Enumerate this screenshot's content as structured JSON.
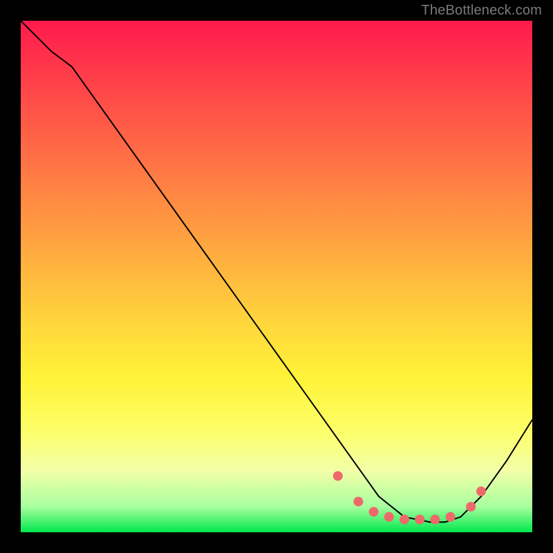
{
  "attribution": "TheBottleneck.com",
  "chart_data": {
    "type": "line",
    "title": "",
    "xlabel": "",
    "ylabel": "",
    "xlim": [
      0,
      100
    ],
    "ylim": [
      0,
      100
    ],
    "series": [
      {
        "name": "bottleneck-curve",
        "x": [
          0,
          6,
          10,
          20,
          30,
          40,
          50,
          55,
          60,
          65,
          70,
          75,
          80,
          83,
          86,
          90,
          95,
          100
        ],
        "y": [
          100,
          94,
          91,
          77,
          63,
          49,
          35,
          28,
          21,
          14,
          7,
          3,
          2,
          2,
          3,
          7,
          14,
          22
        ]
      }
    ],
    "markers": {
      "name": "optimal-zone-dots",
      "color": "#ee6a6a",
      "points": [
        {
          "x": 62,
          "y": 11
        },
        {
          "x": 66,
          "y": 6
        },
        {
          "x": 69,
          "y": 4
        },
        {
          "x": 72,
          "y": 3
        },
        {
          "x": 75,
          "y": 2.5
        },
        {
          "x": 78,
          "y": 2.5
        },
        {
          "x": 81,
          "y": 2.5
        },
        {
          "x": 84,
          "y": 3
        },
        {
          "x": 88,
          "y": 5
        },
        {
          "x": 90,
          "y": 8
        }
      ]
    },
    "background_gradient": {
      "top": "#ff1a4d",
      "mid": "#ffd93b",
      "bottom": "#00e84c"
    }
  }
}
